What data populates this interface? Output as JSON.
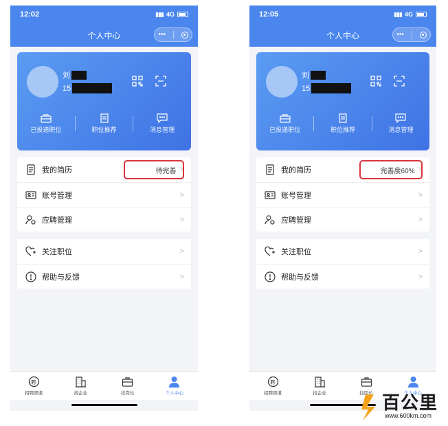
{
  "left": {
    "status": {
      "time": "12:02",
      "network": "4G"
    },
    "nav": {
      "title": "个人中心",
      "more": "•••"
    },
    "profile": {
      "name_prefix": "刘",
      "phone_prefix": "15"
    },
    "quick": [
      "已投递职位",
      "职位推荐",
      "消息管理"
    ],
    "group1": [
      {
        "label": "我的简历",
        "value": "待完善"
      },
      {
        "label": "账号管理",
        "value": ""
      },
      {
        "label": "应聘管理",
        "value": ""
      }
    ],
    "group2": [
      {
        "label": "关注职位"
      },
      {
        "label": "帮助与反馈"
      }
    ],
    "tabs": [
      {
        "label": "招聘频道",
        "active": false
      },
      {
        "label": "找企业",
        "active": false
      },
      {
        "label": "找岗位",
        "active": false
      },
      {
        "label": "个人中心",
        "active": true
      }
    ]
  },
  "right": {
    "status": {
      "time": "12:05",
      "network": "4G"
    },
    "nav": {
      "title": "个人中心",
      "more": "•••"
    },
    "profile": {
      "name_prefix": "刘",
      "phone_prefix": "15"
    },
    "quick": [
      "已投递职位",
      "职位推荐",
      "消息管理"
    ],
    "group1": [
      {
        "label": "我的简历",
        "value": "完善度60%"
      },
      {
        "label": "账号管理",
        "value": ""
      },
      {
        "label": "应聘管理",
        "value": ""
      }
    ],
    "group2": [
      {
        "label": "关注职位"
      },
      {
        "label": "帮助与反馈"
      }
    ],
    "tabs": [
      {
        "label": "招聘频道",
        "active": false
      },
      {
        "label": "找企业",
        "active": false
      },
      {
        "label": "找岗位",
        "active": false
      },
      {
        "label": "个人中心",
        "active": true
      }
    ]
  },
  "watermark": {
    "title": "百公里",
    "url": "www.600km.com"
  },
  "colors": {
    "primary": "#4a86ee",
    "highlight": "#d9343c",
    "background": "#f3f4f8"
  },
  "icons": [
    "qr-code-icon",
    "scan-icon",
    "briefcase-icon",
    "job-recommend-icon",
    "message-icon",
    "resume-icon",
    "account-card-icon",
    "applicant-settings-icon",
    "heart-plus-icon",
    "help-icon",
    "chevron-right-icon"
  ]
}
